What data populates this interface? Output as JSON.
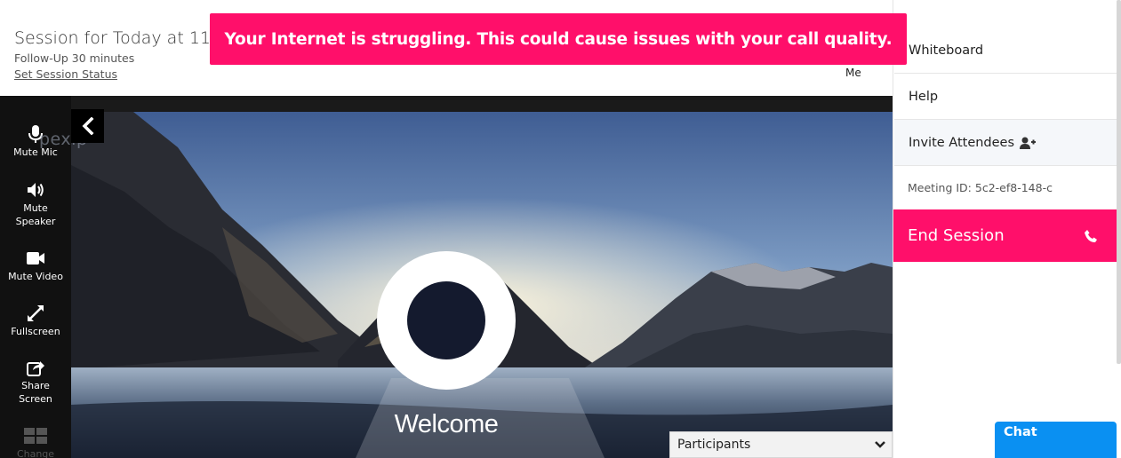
{
  "header": {
    "session_title": "Session for Today at 11:35 AM",
    "followup": "Follow-Up 30 minutes",
    "set_status": "Set Session Status",
    "me_label": "Me"
  },
  "warning_banner": {
    "text": "Your Internet is struggling. This could cause issues with your call quality.",
    "color": "#ff0f6a"
  },
  "toolbar": {
    "items": [
      {
        "label": "Mute Mic",
        "icon": "microphone-icon"
      },
      {
        "label": "Mute Speaker",
        "icon": "speaker-icon"
      },
      {
        "label": "Mute Video",
        "icon": "video-camera-icon"
      },
      {
        "label": "Fullscreen",
        "icon": "expand-icon"
      },
      {
        "label": "Share Screen",
        "icon": "share-icon"
      },
      {
        "label": "Change",
        "icon": "layout-grid-icon"
      }
    ]
  },
  "video": {
    "logo_text": "pexip",
    "welcome_text": "Welcome"
  },
  "participants": {
    "label": "Participants"
  },
  "right_panel": {
    "whiteboard": "Whiteboard",
    "help": "Help",
    "invite": "Invite Attendees",
    "meeting_id": "Meeting ID: 5c2-ef8-148-c",
    "end_session": "End Session",
    "accent_color": "#ff0f6a"
  },
  "chat": {
    "label": "Chat",
    "color": "#0a90f2"
  }
}
